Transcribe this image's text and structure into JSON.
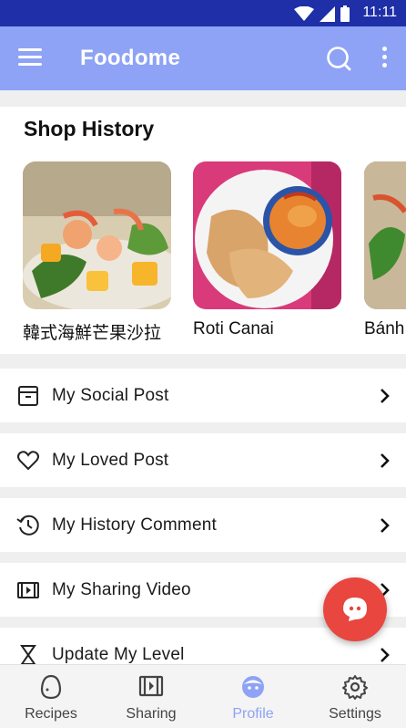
{
  "status_bar": {
    "time": "11:11",
    "icons": [
      "wifi-icon",
      "signal-icon",
      "battery-icon"
    ]
  },
  "app_bar": {
    "title": "Foodome",
    "icons": [
      "menu-icon",
      "search-icon",
      "more-vert-icon"
    ]
  },
  "shop_history": {
    "title": "Shop History",
    "items": [
      {
        "name": "韓式海鮮芒果沙拉"
      },
      {
        "name": "Roti Canai"
      },
      {
        "name": "Bánh"
      }
    ]
  },
  "menu_rows": [
    {
      "label": "My Social Post",
      "icon": "archive-icon"
    },
    {
      "label": "My Loved Post",
      "icon": "heart-icon"
    },
    {
      "label": "My History Comment",
      "icon": "history-icon"
    },
    {
      "label": "My Sharing Video",
      "icon": "video-icon"
    },
    {
      "label": "Update My Level",
      "icon": "hourglass-icon"
    }
  ],
  "bottom_nav": {
    "tabs": [
      {
        "label": "Recipes",
        "icon": "egg-icon"
      },
      {
        "label": "Sharing",
        "icon": "video-icon"
      },
      {
        "label": "Profile",
        "icon": "face-icon",
        "active": true
      },
      {
        "label": "Settings",
        "icon": "gear-icon"
      }
    ]
  },
  "colors": {
    "status_bar": "#1e2fa8",
    "app_bar": "#8ea3f5",
    "fab": "#e8463f",
    "active_tab": "#8ea3f5"
  }
}
